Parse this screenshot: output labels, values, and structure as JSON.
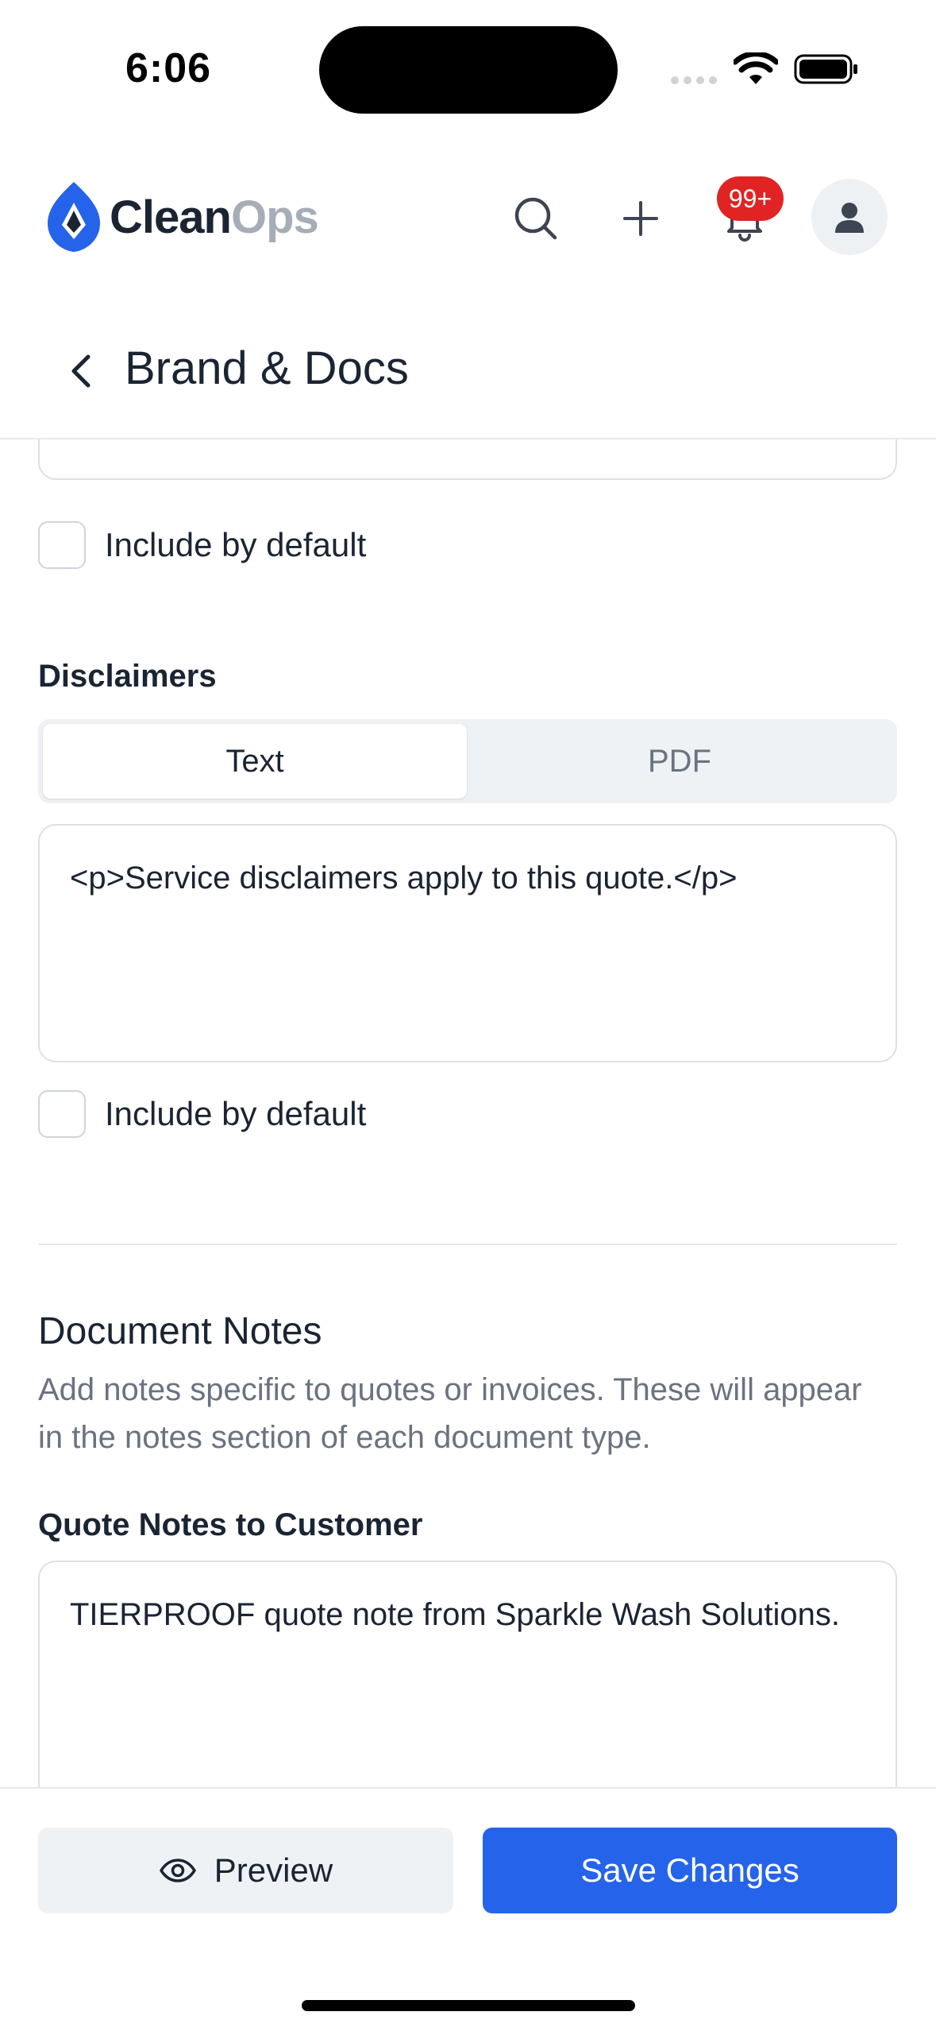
{
  "status_bar": {
    "time": "6:06"
  },
  "header": {
    "logo_primary": "Clean",
    "logo_secondary": "Ops",
    "notification_count": "99+",
    "icons": [
      "search-icon",
      "plus-icon",
      "bell-icon",
      "user-icon"
    ]
  },
  "page": {
    "title": "Brand & Docs"
  },
  "terms_section": {
    "include_label": "Include by default",
    "include_checked": false
  },
  "disclaimers": {
    "label": "Disclaimers",
    "tabs": [
      {
        "label": "Text",
        "active": true
      },
      {
        "label": "PDF",
        "active": false
      }
    ],
    "value": "<p>Service disclaimers apply to this quote.</p>",
    "include_label": "Include by default",
    "include_checked": false
  },
  "document_notes": {
    "title": "Document Notes",
    "description": "Add notes specific to quotes or invoices. These will appear in the notes section of each document type.",
    "quote_notes_label": "Quote Notes to Customer",
    "quote_notes_value": "TIERPROOF quote note from Sparkle Wash Solutions."
  },
  "footer": {
    "preview_label": "Preview",
    "save_label": "Save Changes"
  },
  "colors": {
    "accent": "#2563eb",
    "badge": "#e02424",
    "logo_mark": "#2563eb"
  }
}
